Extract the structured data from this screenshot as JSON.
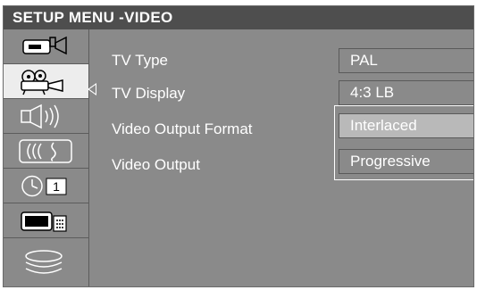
{
  "header": {
    "title": "SETUP MENU -VIDEO"
  },
  "sidebar": {
    "items": [
      {
        "icon": "camcorder-icon"
      },
      {
        "icon": "film-projector-icon"
      },
      {
        "icon": "speaker-icon"
      },
      {
        "icon": "sound-wave-icon"
      },
      {
        "icon": "clock-timer-icon"
      },
      {
        "icon": "tv-remote-icon"
      },
      {
        "icon": "disc-stack-icon"
      }
    ]
  },
  "settings": [
    {
      "label": "TV Type",
      "value": "PAL"
    },
    {
      "label": "TV Display",
      "value": "4:3 LB"
    },
    {
      "label": "Video Output Format",
      "value": ""
    },
    {
      "label": "Video Output",
      "value": ""
    }
  ],
  "options": [
    {
      "label": "Interlaced"
    },
    {
      "label": "Progressive"
    }
  ],
  "timer_icon_digit": "1",
  "colors": {
    "background": "#8a8a8a",
    "title_bar": "#4e4e4e",
    "highlight": "#b9b9b9",
    "text": "#ffffff"
  }
}
